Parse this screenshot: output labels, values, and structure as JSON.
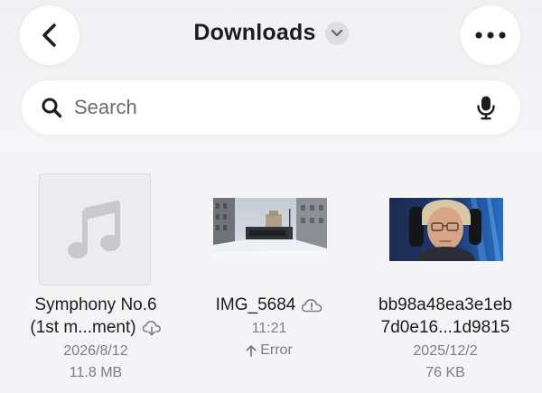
{
  "header": {
    "title": "Downloads",
    "back_icon": "chevron-left-icon",
    "more_icon": "ellipsis-icon",
    "title_menu_icon": "chevron-down-icon"
  },
  "search": {
    "placeholder": "Search",
    "value": "",
    "search_icon": "magnifier-icon",
    "mic_icon": "microphone-icon"
  },
  "files": [
    {
      "name_line1": "Symphony No.6",
      "name_line2": "(1st m...ment)",
      "name_line2_icon": "cloud-download-icon",
      "date": "2026/8/12",
      "size": "11.8 MB",
      "thumb": "music-note-icon"
    },
    {
      "name_line1": "IMG_5684",
      "name_line1_icon": "cloud-alert-icon",
      "time": "11:21",
      "status": "Error",
      "status_icon": "arrow-up-icon",
      "thumb": "snowy-street-photo"
    },
    {
      "name_line1": "bb98a48ea3e1eb",
      "name_line2": "7d0e16...1d9815",
      "date": "2025/12/2",
      "size": "76 KB",
      "thumb": "gamer-portrait-photo"
    }
  ],
  "colors": {
    "background": "#f4f4f6",
    "card": "#ffffff",
    "text_primary": "#1c1c1e",
    "text_secondary": "#7d7d82"
  }
}
